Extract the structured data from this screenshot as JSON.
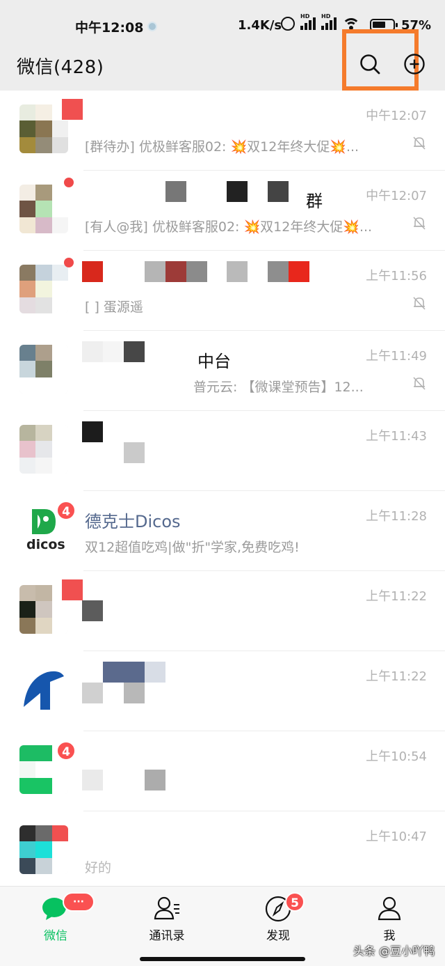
{
  "status_bar": {
    "time": "中午12:08",
    "network_speed": "1.4K/s",
    "signal_label": "HD",
    "battery": "57%"
  },
  "header": {
    "title": "微信(428)"
  },
  "chats": [
    {
      "name": "",
      "preview": "[群待办] 优极鲜客服02: 💥双12年终大促💥...",
      "time": "中午12:07",
      "muted": true
    },
    {
      "name": "群",
      "preview": "[有人@我] 优极鲜客服02: 💥双12年终大促💥...",
      "time": "中午12:07",
      "muted": true
    },
    {
      "name": "",
      "preview": "[  ] 蛋源遥",
      "time": "上午11:56",
      "muted": true
    },
    {
      "name": "中台",
      "preview": "普元云: 【微课堂预告】12...",
      "time": "上午11:49",
      "muted": true
    },
    {
      "name": "",
      "preview": "",
      "time": "上午11:43",
      "muted": false
    },
    {
      "name": "德克士Dicos",
      "preview": "双12超值吃鸡|做\"折\"学家,免费吃鸡!",
      "time": "上午11:28",
      "muted": false,
      "badge": "4",
      "avatar_text": "dicos"
    },
    {
      "name": "",
      "preview": "",
      "time": "上午11:22",
      "muted": false
    },
    {
      "name": "",
      "preview": "",
      "time": "上午11:22",
      "muted": false
    },
    {
      "name": "",
      "preview": "",
      "time": "上午10:54",
      "muted": false,
      "badge": "4"
    },
    {
      "name": "",
      "preview": "好的",
      "time": "上午10:47",
      "muted": false
    }
  ],
  "tabbar": {
    "tabs": [
      {
        "label": "微信",
        "badge": "···",
        "active": true
      },
      {
        "label": "通讯录"
      },
      {
        "label": "发现",
        "badge": "5"
      },
      {
        "label": "我"
      }
    ]
  },
  "watermark": "头条 @豆小吖鸭",
  "colors": {
    "accent": "#07c160",
    "badge": "#fa5151",
    "highlight": "#f57b2c"
  }
}
